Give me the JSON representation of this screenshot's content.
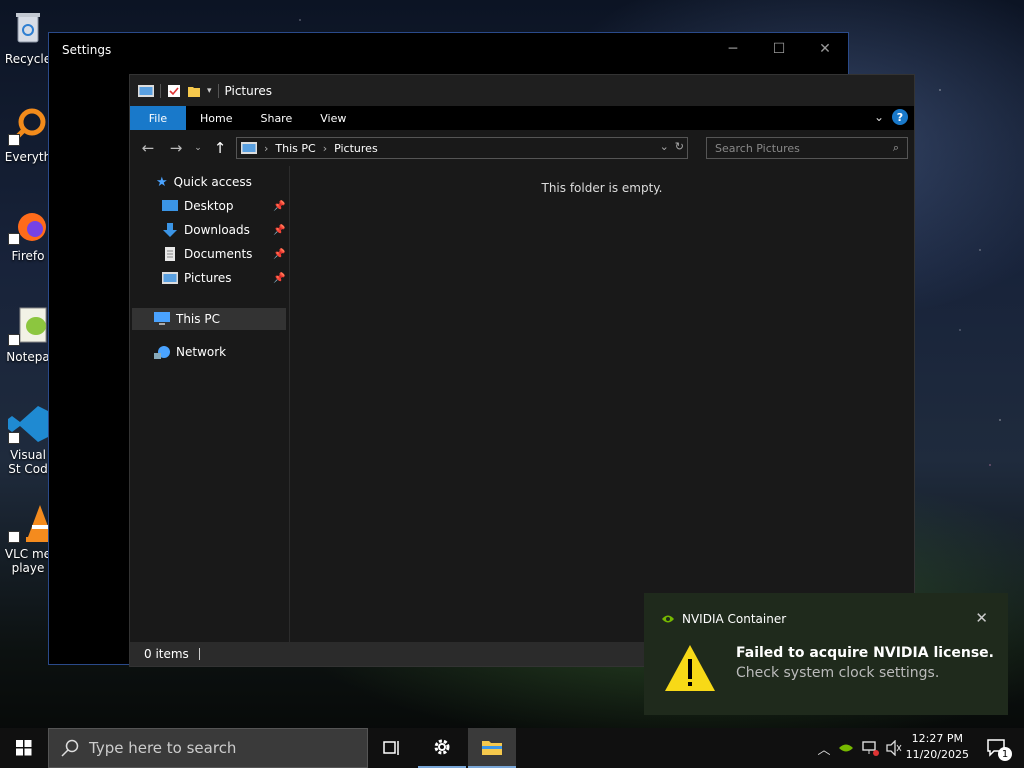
{
  "desktop": {
    "icons": [
      {
        "label": "Recycle",
        "icon": "recycle-bin-icon"
      },
      {
        "label": "Everyth",
        "icon": "everything-icon"
      },
      {
        "label": "Firefo",
        "icon": "firefox-icon"
      },
      {
        "label": "Notepa",
        "icon": "notepad-plus-icon"
      },
      {
        "label": "Visual St Cod",
        "icon": "vscode-icon"
      },
      {
        "label": "VLC me playe",
        "icon": "vlc-icon"
      }
    ]
  },
  "settings_window": {
    "title": "Settings",
    "controls": {
      "minimize": "─",
      "maximize": "☐",
      "close": "✕"
    }
  },
  "explorer": {
    "title": "Pictures",
    "ribbon": {
      "tabs": [
        "File",
        "Home",
        "Share",
        "View"
      ],
      "help": "?"
    },
    "address": {
      "crumbs": [
        "This PC",
        "Pictures"
      ]
    },
    "search": {
      "placeholder": "Search Pictures"
    },
    "nav": {
      "quick_access": "Quick access",
      "items": [
        {
          "label": "Desktop",
          "icon": "desktop-folder-icon"
        },
        {
          "label": "Downloads",
          "icon": "downloads-folder-icon"
        },
        {
          "label": "Documents",
          "icon": "documents-folder-icon"
        },
        {
          "label": "Pictures",
          "icon": "pictures-folder-icon"
        }
      ],
      "this_pc": "This PC",
      "network": "Network"
    },
    "empty_message": "This folder is empty.",
    "status": {
      "items": "0 items"
    }
  },
  "notification": {
    "app": "NVIDIA Container",
    "title": "Failed to acquire NVIDIA license.",
    "body": "Check system clock settings.",
    "accent": "#76b900"
  },
  "taskbar": {
    "search_placeholder": "Type here to search",
    "clock": {
      "time": "12:27 PM",
      "date": "11/20/2025"
    },
    "notification_count": "1"
  }
}
